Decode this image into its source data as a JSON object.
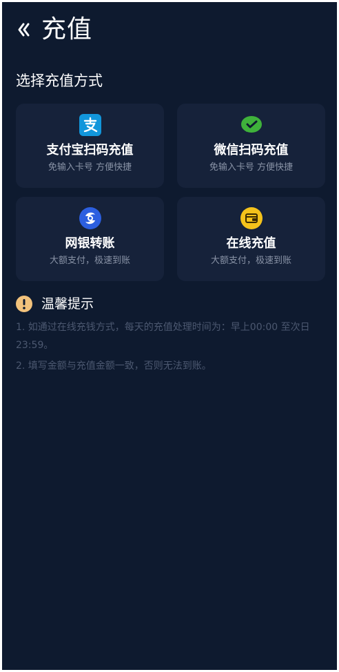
{
  "header": {
    "back_icon": "chevron-double-left-icon",
    "title": "充值"
  },
  "section": {
    "title": "选择充值方式"
  },
  "methods": [
    {
      "name": "支付宝扫码充值",
      "desc": "免输入卡号 方便快捷",
      "icon": "alipay-icon",
      "color": "#1296db"
    },
    {
      "name": "微信扫码充值",
      "desc": "免输入卡号 方便快捷",
      "icon": "wechat-icon",
      "color": "#3fb23b"
    },
    {
      "name": "网银转账",
      "desc": "大额支付，极速到账",
      "icon": "bank-transfer-icon",
      "color": "#2c5fe0"
    },
    {
      "name": "在线充值",
      "desc": "大额支付，极速到账",
      "icon": "wallet-icon",
      "color": "#f4c21b"
    }
  ],
  "tips": {
    "icon": "warning-icon",
    "title": "温馨提示",
    "items": [
      "1. 如通过在线充钱方式，每天的充值处理时间为：早上00:00 至次日 23:59。",
      "2. 填写金额与充值金额一致，否则无法到账。"
    ]
  },
  "colors": {
    "background": "#0e1a2f",
    "card": "#16223a",
    "muted_text": "#8993a6",
    "tip_text": "#4c5870",
    "warning": "#f2c27c"
  }
}
